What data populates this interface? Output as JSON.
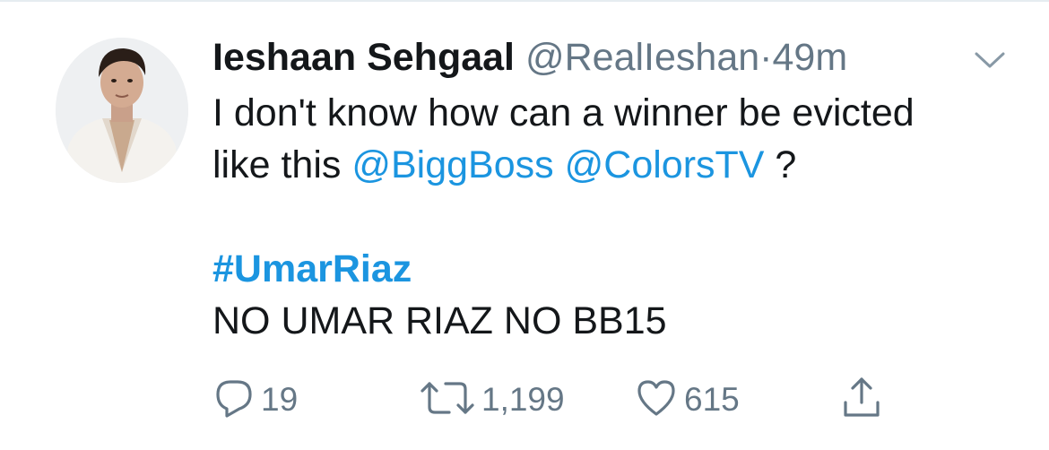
{
  "tweet": {
    "display_name": "Ieshaan Sehgaal",
    "handle": "@RealIeshan",
    "separator": "·",
    "time": "49m",
    "text": {
      "line1": "I don't know how can a winner be evicted",
      "line2_prefix": "like this ",
      "mention1": "@BiggBoss",
      "mention2": "@ColorsTV",
      "line2_suffix": " ?",
      "hashtag": "#UmarRiaz",
      "line4": "NO UMAR RIAZ NO BB15"
    },
    "actions": {
      "reply_count": "19",
      "retweet_count": "1,199",
      "like_count": "615"
    }
  },
  "icons": {
    "reply": "reply-icon",
    "retweet": "retweet-icon",
    "like": "heart-icon",
    "share": "share-icon",
    "menu": "chevron-down-icon"
  },
  "colors": {
    "link": "#1b95e0",
    "secondary": "#657786",
    "text": "#14171a"
  }
}
